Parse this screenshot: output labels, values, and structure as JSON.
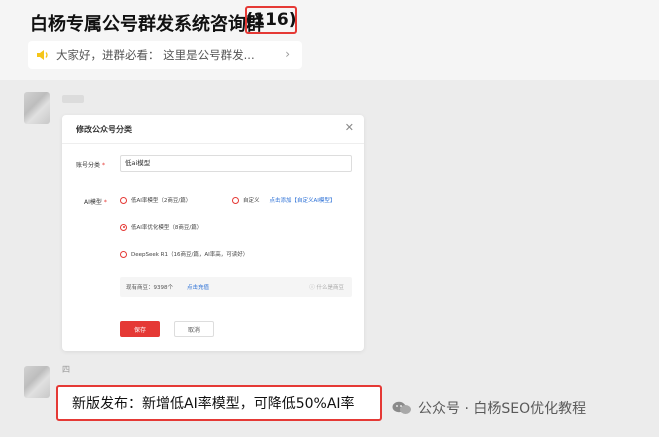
{
  "header": {
    "group_title": "白杨专属公号群发系统咨询群",
    "member_count": "(116)",
    "notice": "大家好，进群必看：  这里是公号群发..."
  },
  "dialog": {
    "title": "修改公众号分类",
    "account_category_label": "账号分类",
    "account_category_value": "低ai模型",
    "ai_model_label": "AI模型",
    "options": {
      "low_ai": "低AI率模型（2商豆/篇）",
      "custom": "自定义",
      "custom_link": "点击添加【自定义AI模型】",
      "low_ai_optimized": "低AI率优化模型（8商豆/篇）",
      "deepseek": "DeepSeek R1（16商豆/篇，AI率高，可读好）"
    },
    "balance_text": "现有商豆：9398个",
    "recharge_link": "点击充值",
    "what_is_bean": "ⓘ 什么是商豆",
    "save_label": "保存",
    "cancel_label": "取消"
  },
  "chat": {
    "sender_initial": "四",
    "announcement": "新版发布：新增低AI率模型，可降低50%AI率"
  },
  "watermark": {
    "text": "公众号 · 白杨SEO优化教程"
  },
  "colors": {
    "accent": "#e53935",
    "link": "#2a6fd6"
  }
}
